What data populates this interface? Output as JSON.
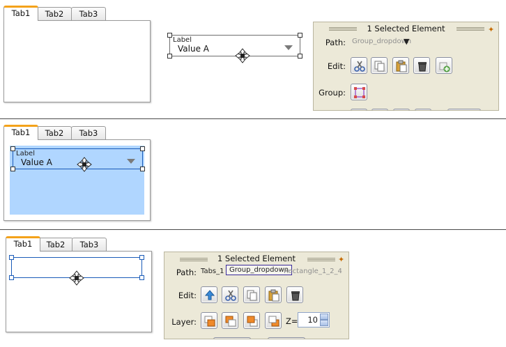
{
  "tabs": [
    "Tab1",
    "Tab2",
    "Tab3"
  ],
  "dropdown": {
    "label": "Label",
    "value": "Value A"
  },
  "panel_top": {
    "title": "1 Selected Element",
    "path_label": "Path:",
    "path_value": "Group_dropdown",
    "edit_label": "Edit:",
    "group_label": "Group:"
  },
  "panel_bottom": {
    "title": "1 Selected Element",
    "path_label": "Path:",
    "path_items": [
      "Tabs_1",
      "Group_dropdown",
      "Rectangle_1_2_4"
    ],
    "edit_label": "Edit:",
    "layer_label": "Layer:",
    "z_label": "Z=",
    "z_value": "10"
  },
  "colors": {
    "active_tab_accent": "#f4a21a",
    "selection_fill": "#b0d6ff",
    "panel_bg": "#ece9d8"
  }
}
